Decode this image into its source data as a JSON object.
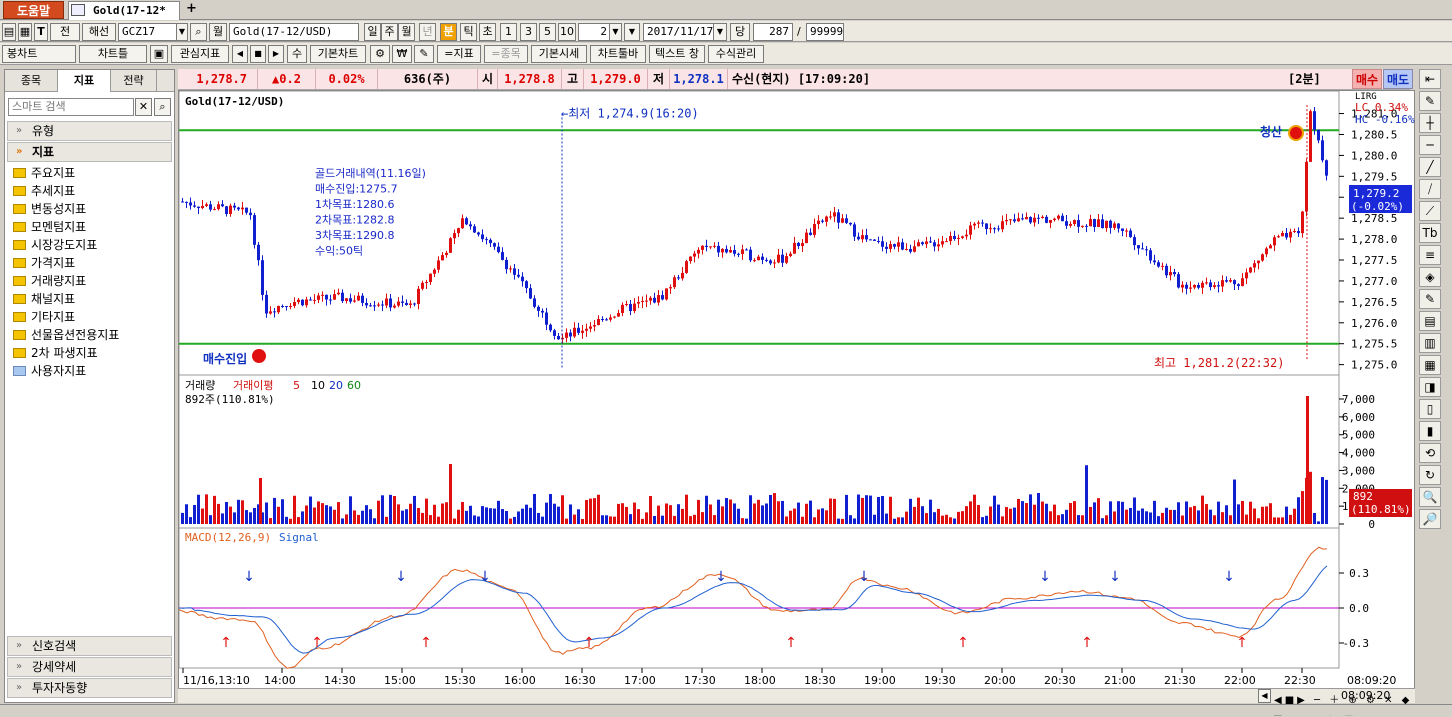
{
  "tabbar": {
    "help": "도움말",
    "doc_tab": "Gold(17-12*",
    "plus": "+"
  },
  "toolbar1": {
    "btn_jeon": "전",
    "btn_haeseon": "해선",
    "symbol_code": "GCZ17",
    "btn_wol": "월",
    "symbol_name": "Gold(17-12/USD)",
    "periods": [
      "일",
      "주",
      "월",
      "년",
      "분",
      "틱",
      "초"
    ],
    "active_period": "분",
    "minutes": [
      "1",
      "3",
      "5",
      "10"
    ],
    "interval_value": "2",
    "date_value": "2017/11/17",
    "btn_dang": "당",
    "count_value": "287",
    "slash": "/",
    "max_value": "99999"
  },
  "toolbar2": {
    "bong_chart": "봉차트",
    "chart_type": "차트틀",
    "gwansim": "관심지표",
    "cnt": "수",
    "basic_chart": "기본차트",
    "won": "₩",
    "jipyo": "=지표",
    "jongmok": "=종목",
    "basic_price": "기본시세",
    "chart_toolbar": "차트툴바",
    "text_window": "텍스트 창",
    "formula_mgmt": "수식관리"
  },
  "left_panel": {
    "tabs": [
      "종목",
      "지표",
      "전략"
    ],
    "active_tab": "지표",
    "search_placeholder": "스마트 검색",
    "sections_top": [
      "유형",
      "지표"
    ],
    "folders": [
      "주요지표",
      "추세지표",
      "변동성지표",
      "모멘텀지표",
      "시장강도지표",
      "가격지표",
      "거래량지표",
      "채널지표",
      "기타지표",
      "선물옵션전용지표",
      "2차 파생지표",
      "사용자지표"
    ],
    "sections_bottom": [
      "신호검색",
      "강세약세",
      "투자자동향"
    ]
  },
  "quote": {
    "price": "1,278.7",
    "change": "▲0.2",
    "pct": "0.02%",
    "volume": "636(주)",
    "open_label": "시",
    "open": "1,278.8",
    "high_label": "고",
    "high": "1,279.0",
    "low_label": "저",
    "low": "1,278.1",
    "recv": "수신(현지) [17:09:20]",
    "interval": "[2분]",
    "buy": "매수",
    "sell": "매도"
  },
  "main_chart": {
    "title": "Gold(17-12/USD)",
    "lirg": "LIRG",
    "lc": "LC  0.34%",
    "hc": "HC -0.16%",
    "price_ticks": [
      "1,281.0",
      "1,280.5",
      "1,280.0",
      "1,279.5",
      "1,279.0",
      "1,278.5",
      "1,278.0",
      "1,277.5",
      "1,277.0",
      "1,276.5",
      "1,276.0",
      "1,275.5",
      "1,275.0"
    ],
    "current_price": "1,279.2",
    "current_pct": "(-0.02%)",
    "low_annot": "←최저 1,274.9(16:20)",
    "high_annot": "최고 1,281.2(22:32)",
    "trade_info": [
      "골드거래내역(11.16일)",
      "매수진입:1275.7",
      "1차목표:1280.6",
      "2차목표:1282.8",
      "3차목표:1290.8",
      "수익:50틱"
    ],
    "entry_label": "매수진입",
    "exit_label": "청산"
  },
  "volume": {
    "legend_vol": "거래량",
    "legend_ma": "거래이평",
    "ma": [
      "5",
      "10",
      "20",
      "60"
    ],
    "value": "892주(110.81%)",
    "ticks": [
      "7,000",
      "6,000",
      "5,000",
      "4,000",
      "3,000",
      "2,000",
      "1,000",
      "0"
    ],
    "current": "892",
    "current_pct": "(110.81%)"
  },
  "macd": {
    "legend": "MACD(12,26,9)",
    "signal": "Signal",
    "ticks": [
      "0.3",
      "0.0",
      "-0.3"
    ]
  },
  "x_axis": {
    "labels": [
      "11/16,13:10",
      "14:00",
      "14:30",
      "15:00",
      "15:30",
      "16:00",
      "16:30",
      "17:00",
      "17:30",
      "18:00",
      "18:30",
      "19:00",
      "19:30",
      "20:00",
      "20:30",
      "21:00",
      "21:30",
      "22:00",
      "22:30"
    ],
    "time": "08:09:20"
  },
  "chart_data": {
    "type": "candlestick",
    "price_range": [
      1274.9,
      1281.2
    ],
    "support": 1275.5,
    "resistance": 1280.6,
    "entry_price": 1275.7,
    "exit_price": 1280.6,
    "macd_range": [
      -0.4,
      0.5
    ]
  },
  "colors": {
    "up": "#e01010",
    "down": "#1020d0",
    "support": "#22aa22",
    "ma_line": "#000000",
    "macd": "#e06020",
    "signal": "#2060d0",
    "zero": "#c000c0"
  }
}
